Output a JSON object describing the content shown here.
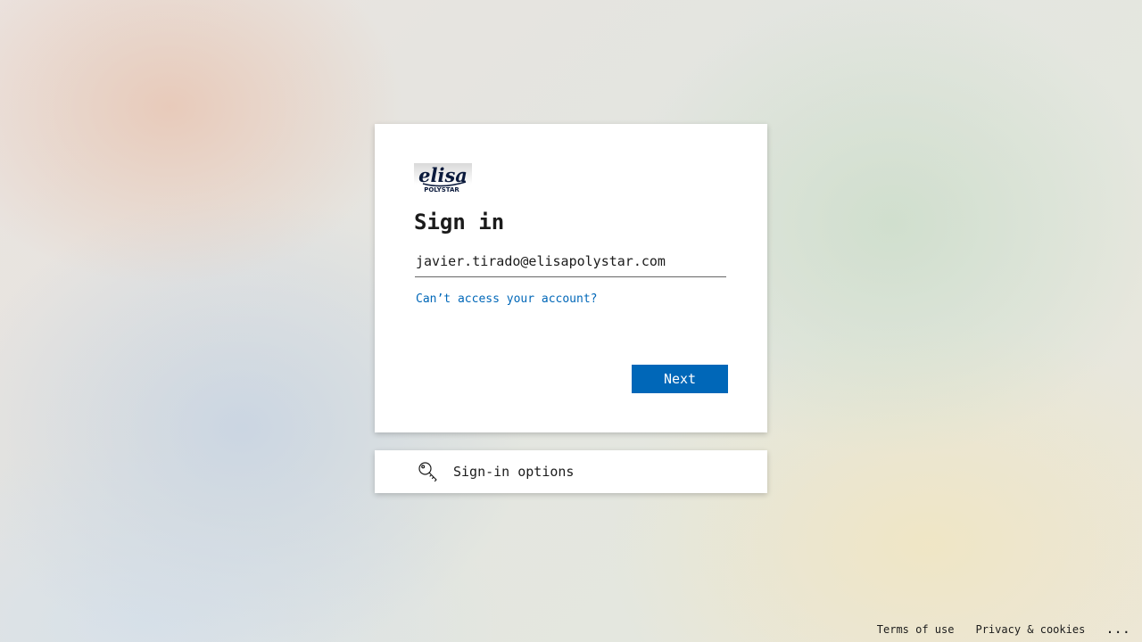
{
  "brand": {
    "logo_text": "elisa",
    "logo_subtext": "POLYSTAR",
    "logo_color": "#0b1a3c"
  },
  "signin": {
    "title": "Sign in",
    "email_value": "javier.tirado@elisapolystar.com",
    "cant_access_link": "Can’t access your account?",
    "next_button": "Next"
  },
  "options": {
    "icon": "key-icon",
    "label": "Sign-in options"
  },
  "footer": {
    "terms": "Terms of use",
    "privacy": "Privacy & cookies",
    "more": "..."
  },
  "colors": {
    "accent": "#0067b8",
    "text": "#1b1b1b"
  }
}
